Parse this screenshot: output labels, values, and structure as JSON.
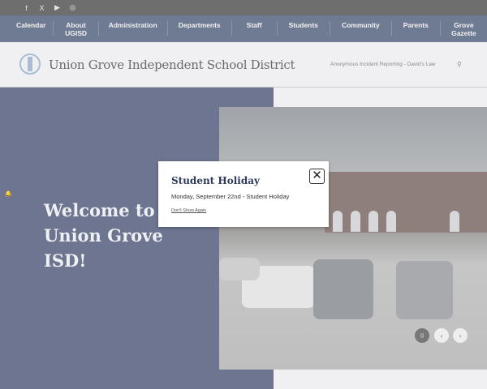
{
  "social": [
    {
      "icon": "facebook-icon",
      "glyph": "f"
    },
    {
      "icon": "x-icon",
      "glyph": "X"
    },
    {
      "icon": "youtube-icon",
      "glyph": "▶"
    },
    {
      "icon": "instagram-icon",
      "glyph": "◎"
    }
  ],
  "nav": [
    "Calendar",
    "About UGISD",
    "Administration",
    "Departments",
    "Staff",
    "Students",
    "Community",
    "Parents",
    "Grove Gazette"
  ],
  "header": {
    "title": "Union Grove Independent School District",
    "anon_link": "Anonymous Incident Reporting - David's Law",
    "search_glyph": "⚲"
  },
  "hero": {
    "welcome": "Welcome to Union Grove ISD!"
  },
  "slider": {
    "pause": "II",
    "prev": "‹",
    "next": "›"
  },
  "modal": {
    "title": "Student Holiday",
    "message": "Monday, September 22nd - Student Holiday",
    "dont_show": "Don't Show Again",
    "close": "✕"
  },
  "colors": {
    "nav": "#6f7a93",
    "panel": "#6d7590",
    "modal_title": "#2e3a5c"
  }
}
